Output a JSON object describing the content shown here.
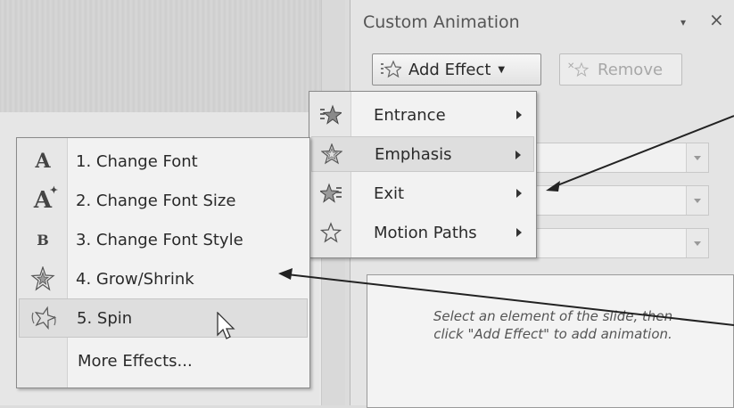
{
  "pane": {
    "title": "Custom Animation",
    "dropdown_glyph": "▾",
    "close_glyph": "×",
    "add_effect": "Add Effect",
    "remove": "Remove",
    "hint_line1": "Select an element of the slide, then",
    "hint_line2": "click \"Add Effect\" to add animation."
  },
  "add_effect_menu": [
    {
      "label": "Entrance",
      "icon": "entrance-star-icon"
    },
    {
      "label": "Emphasis",
      "icon": "emphasis-star-icon",
      "highlighted": true
    },
    {
      "label": "Exit",
      "icon": "exit-star-icon"
    },
    {
      "label": "Motion Paths",
      "icon": "motion-path-star-icon"
    }
  ],
  "emphasis_submenu": [
    {
      "label": "1. Change Font",
      "icon": "font-A-icon",
      "glyph": "A"
    },
    {
      "label": "2. Change Font Size",
      "icon": "font-size-icon",
      "glyph": "A"
    },
    {
      "label": "3. Change Font Style",
      "icon": "font-style-icon",
      "glyph": "B"
    },
    {
      "label": "4. Grow/Shrink",
      "icon": "grow-shrink-icon"
    },
    {
      "label": "5. Spin",
      "icon": "spin-icon",
      "highlighted": true
    },
    {
      "label": "More Effects..."
    }
  ]
}
